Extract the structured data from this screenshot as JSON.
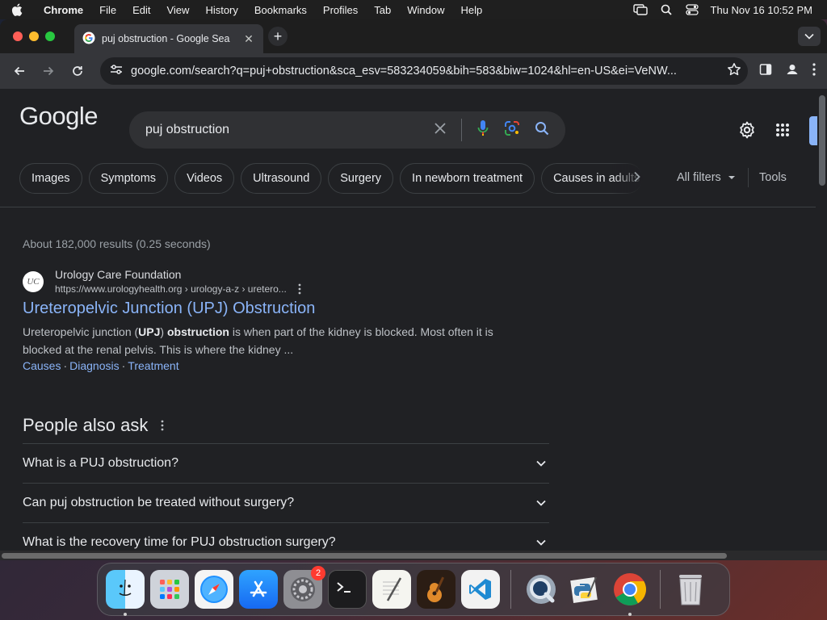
{
  "menubar": {
    "app_name": "Chrome",
    "items": [
      "File",
      "Edit",
      "View",
      "History",
      "Bookmarks",
      "Profiles",
      "Tab",
      "Window",
      "Help"
    ],
    "clock": "Thu Nov 16  10:52 PM"
  },
  "browser": {
    "tab_title": "puj obstruction - Google Sea",
    "url": "google.com/search?q=puj+obstruction&sca_esv=583234059&bih=583&biw=1024&hl=en-US&ei=VeNW..."
  },
  "search": {
    "logo": "Google",
    "query": "puj obstruction",
    "chips": [
      "Images",
      "Symptoms",
      "Videos",
      "Ultrasound",
      "Surgery",
      "In newborn treatment",
      "Causes in adults"
    ],
    "all_filters": "All filters",
    "tools": "Tools",
    "stats": "About 182,000 results (0.25 seconds)"
  },
  "result": {
    "favicon_text": "UC",
    "site_name": "Urology Care Foundation",
    "cite": "https://www.urologyhealth.org › urology-a-z › uretero...",
    "title": "Ureteropelvic Junction (UPJ) Obstruction",
    "snippet_1": "Ureteropelvic junction (",
    "snippet_b1": "UPJ",
    "snippet_2": ") ",
    "snippet_b2": "obstruction",
    "snippet_3": " is when part of the kidney is blocked. Most often it is blocked at the renal pelvis. This is where the kidney ...",
    "sitelinks": [
      "Causes",
      "Diagnosis",
      "Treatment"
    ]
  },
  "people_also_ask": {
    "heading": "People also ask",
    "questions": [
      "What is a PUJ obstruction?",
      "Can puj obstruction be treated without surgery?",
      "What is the recovery time for PUJ obstruction surgery?"
    ]
  },
  "dock": {
    "settings_badge": "2"
  },
  "colors": {
    "link_blue": "#8ab4f8",
    "page_bg": "#202124",
    "searchbox_bg": "#303134"
  }
}
